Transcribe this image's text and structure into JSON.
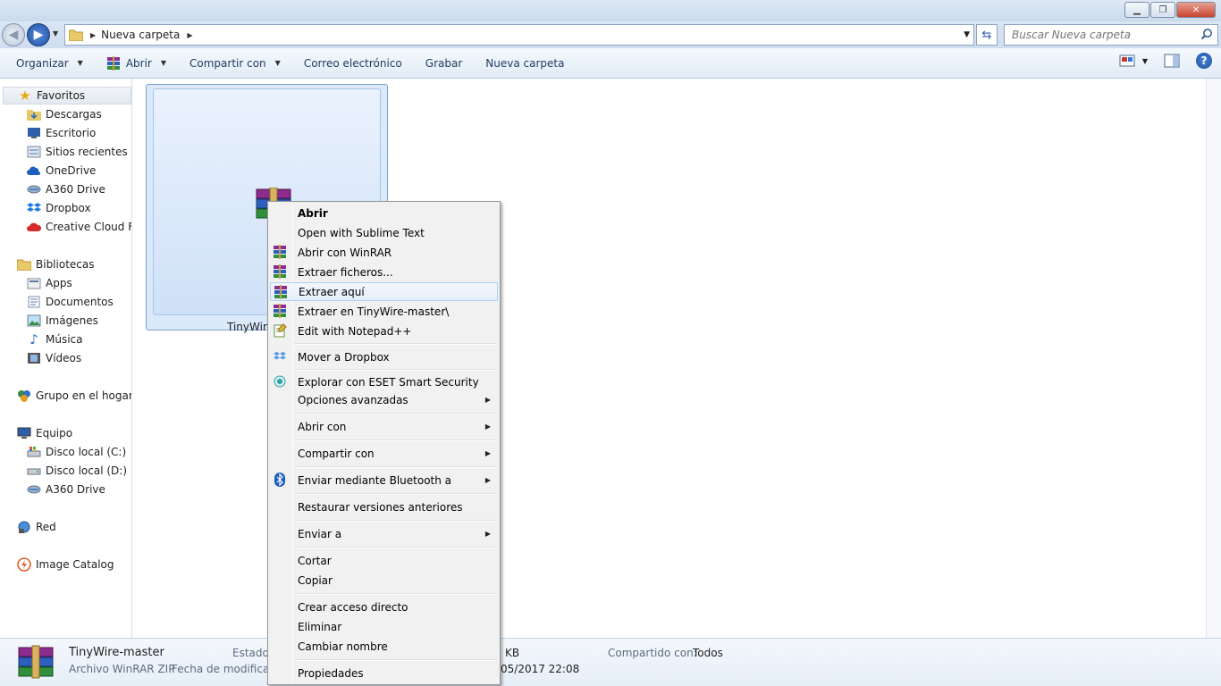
{
  "window": {
    "controls": {
      "minimize": "▁",
      "maximize": "❐",
      "close": "✕"
    }
  },
  "address_bar": {
    "breadcrumb": "Nueva carpeta",
    "search_placeholder": "Buscar Nueva carpeta"
  },
  "toolbar": {
    "items": [
      "Organizar",
      "Abrir",
      "Compartir con",
      "Correo electrónico",
      "Grabar",
      "Nueva carpeta"
    ]
  },
  "nav": {
    "favorites": {
      "label": "Favoritos",
      "items": [
        "Descargas",
        "Escritorio",
        "Sitios recientes",
        "OneDrive",
        "A360 Drive",
        "Dropbox",
        "Creative Cloud Files"
      ]
    },
    "libraries": {
      "label": "Bibliotecas",
      "items": [
        "Apps",
        "Documentos",
        "Imágenes",
        "Música",
        "Vídeos"
      ]
    },
    "homegroup": "Grupo en el hogar",
    "computer": {
      "label": "Equipo",
      "items": [
        "Disco local (C:)",
        "Disco local (D:)",
        "A360 Drive"
      ]
    },
    "network": "Red",
    "image_catalog": "Image Catalog"
  },
  "file": {
    "name": "TinyWire-master",
    "label_visible": "TinyWire-"
  },
  "context_menu": {
    "items": [
      {
        "label": "Abrir",
        "bold": true
      },
      {
        "label": "Open with Sublime Text"
      },
      {
        "label": "Abrir con WinRAR",
        "icon": "winrar-icon"
      },
      {
        "label": "Extraer ficheros...",
        "icon": "winrar-icon"
      },
      {
        "label": "Extraer aquí",
        "icon": "winrar-icon",
        "highlighted": true
      },
      {
        "label": "Extraer en TinyWire-master\\",
        "icon": "winrar-icon"
      },
      {
        "label": "Edit with Notepad++",
        "icon": "notepadpp-icon"
      },
      {
        "label": "Mover a Dropbox",
        "icon": "dropbox-icon"
      },
      {
        "label": "Explorar con ESET Smart Security",
        "icon": "eset-icon"
      },
      {
        "label": "Opciones avanzadas",
        "submenu": true
      },
      {
        "label": "Abrir con",
        "submenu": true
      },
      {
        "label": "Compartir con",
        "submenu": true
      },
      {
        "label": "Enviar mediante Bluetooth a",
        "icon": "bluetooth-icon",
        "submenu": true
      },
      {
        "label": "Restaurar versiones anteriores"
      },
      {
        "label": "Enviar a",
        "submenu": true
      },
      {
        "label": "Cortar"
      },
      {
        "label": "Copiar"
      },
      {
        "label": "Crear acceso directo"
      },
      {
        "label": "Eliminar"
      },
      {
        "label": "Cambiar nombre"
      },
      {
        "label": "Propiedades"
      }
    ]
  },
  "details": {
    "name": "TinyWire-master",
    "type": "Archivo WinRAR ZIP",
    "status_label": "Estado:",
    "modified_label": "Fecha de modifica...",
    "size_fragment": "KB",
    "date_fragment": "05/2017 22:08",
    "shared_label": "Compartido con:",
    "shared_value": "Todos"
  },
  "colors": {
    "accent": "#1e4f9e",
    "selection": "#dbeafb",
    "menu_bg": "#f1f1f1"
  }
}
